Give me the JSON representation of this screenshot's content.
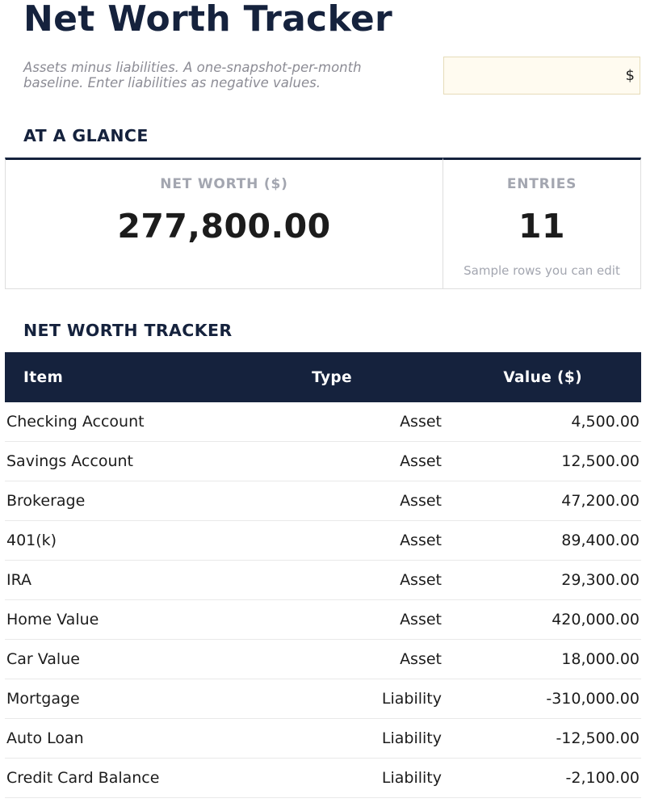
{
  "title": "Net Worth Tracker",
  "subtitle": "Assets minus liabilities. A one-snapshot-per-month baseline. Enter liabilities as negative values.",
  "currency_input": {
    "value": "$"
  },
  "glance": {
    "heading": "AT A GLANCE",
    "net_worth": {
      "label": "NET WORTH ($)",
      "value": "277,800.00"
    },
    "entries": {
      "label": "ENTRIES",
      "value": "11",
      "note": "Sample rows you can edit"
    }
  },
  "tracker": {
    "heading": "NET WORTH TRACKER",
    "columns": {
      "item": "Item",
      "type": "Type",
      "value": "Value ($)"
    },
    "rows": [
      {
        "item": "Checking Account",
        "type": "Asset",
        "value": "4,500.00"
      },
      {
        "item": "Savings Account",
        "type": "Asset",
        "value": "12,500.00"
      },
      {
        "item": "Brokerage",
        "type": "Asset",
        "value": "47,200.00"
      },
      {
        "item": "401(k)",
        "type": "Asset",
        "value": "89,400.00"
      },
      {
        "item": "IRA",
        "type": "Asset",
        "value": "29,300.00"
      },
      {
        "item": "Home Value",
        "type": "Asset",
        "value": "420,000.00"
      },
      {
        "item": "Car Value",
        "type": "Asset",
        "value": "18,000.00"
      },
      {
        "item": "Mortgage",
        "type": "Liability",
        "value": "-310,000.00"
      },
      {
        "item": "Auto Loan",
        "type": "Liability",
        "value": "-12,500.00"
      },
      {
        "item": "Credit Card Balance",
        "type": "Liability",
        "value": "-2,100.00"
      }
    ]
  },
  "colors": {
    "brand_navy": "#15223d",
    "input_background": "#fffbf0",
    "muted_label": "#a3a6b0"
  }
}
